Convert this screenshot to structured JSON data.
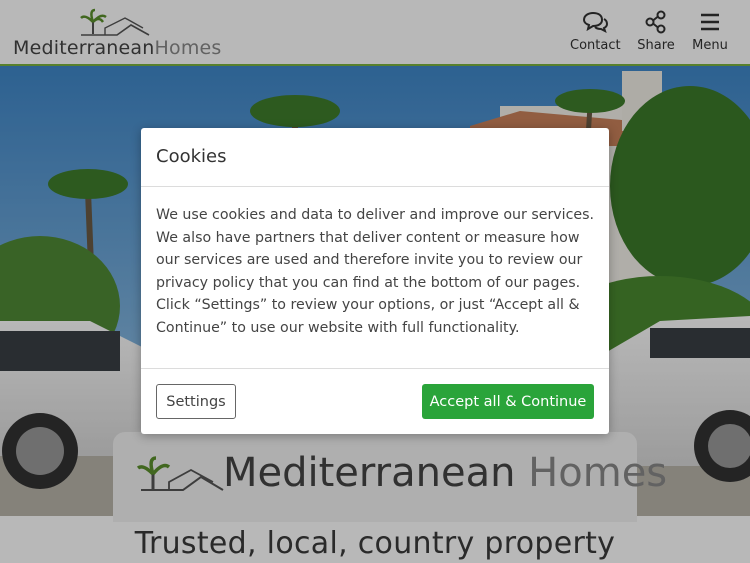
{
  "header": {
    "logo": {
      "brand_main": "Mediterranean",
      "brand_light": "Homes"
    },
    "nav": [
      {
        "label": "Contact",
        "icon": "chat-bubbles-icon"
      },
      {
        "label": "Share",
        "icon": "share-icon"
      },
      {
        "label": "Menu",
        "icon": "hamburger-menu-icon"
      }
    ]
  },
  "hero": {
    "card_logo": {
      "brand_main": "Mediterranean",
      "brand_light": "Homes"
    },
    "tagline": "Trusted, local, country property"
  },
  "cookie_modal": {
    "title": "Cookies",
    "body": "We use cookies and data to deliver and improve our services. We also have partners that deliver content or measure how our services are used and therefore invite you to review our privacy policy that you can find at the bottom of our pages. Click “Settings” to review your options, or just “Accept all & Continue” to use our website with full functionality.",
    "settings_label": "Settings",
    "accept_label": "Accept all & Continue"
  },
  "colors": {
    "accent_green": "#2aa43a",
    "header_border": "#7bb23e",
    "palm_green": "#5a8f2c"
  }
}
